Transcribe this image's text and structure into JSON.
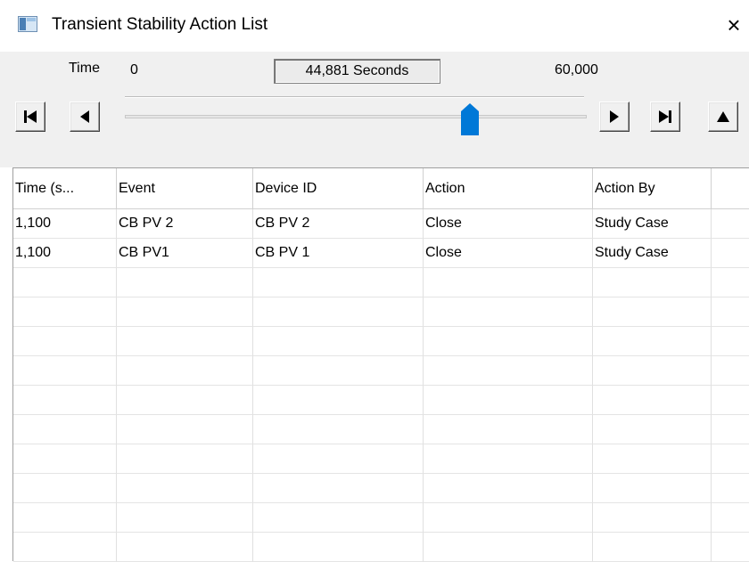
{
  "window": {
    "title": "Transient Stability Action List",
    "close_glyph": "×",
    "icon": "app-window-icon"
  },
  "timebar": {
    "label": "Time",
    "range_min": "0",
    "range_max": "60,000",
    "current_display": "44,881 Seconds",
    "current_value": 44881,
    "slider_max": 60000
  },
  "buttons": [
    {
      "name": "skip-to-start-button",
      "icon": "skip-start-icon"
    },
    {
      "name": "step-back-button",
      "icon": "step-back-icon"
    },
    {
      "name": "step-forward-button",
      "icon": "step-forward-icon"
    },
    {
      "name": "skip-to-end-button",
      "icon": "skip-end-icon"
    },
    {
      "name": "collapse-button",
      "icon": "triangle-up-icon"
    }
  ],
  "table": {
    "columns": [
      "Time (s...",
      "Event",
      "Device ID",
      "Action",
      "Action By",
      ""
    ],
    "rows": [
      [
        "1,100",
        "CB PV 2",
        "CB PV 2",
        "Close",
        "Study Case",
        ""
      ],
      [
        "1,100",
        "CB PV1",
        "CB PV 1",
        "Close",
        "Study Case",
        ""
      ]
    ],
    "empty_rows": 10
  },
  "colors": {
    "thumb": "#0078d7",
    "toolbar_bg": "#f0f0f0"
  }
}
